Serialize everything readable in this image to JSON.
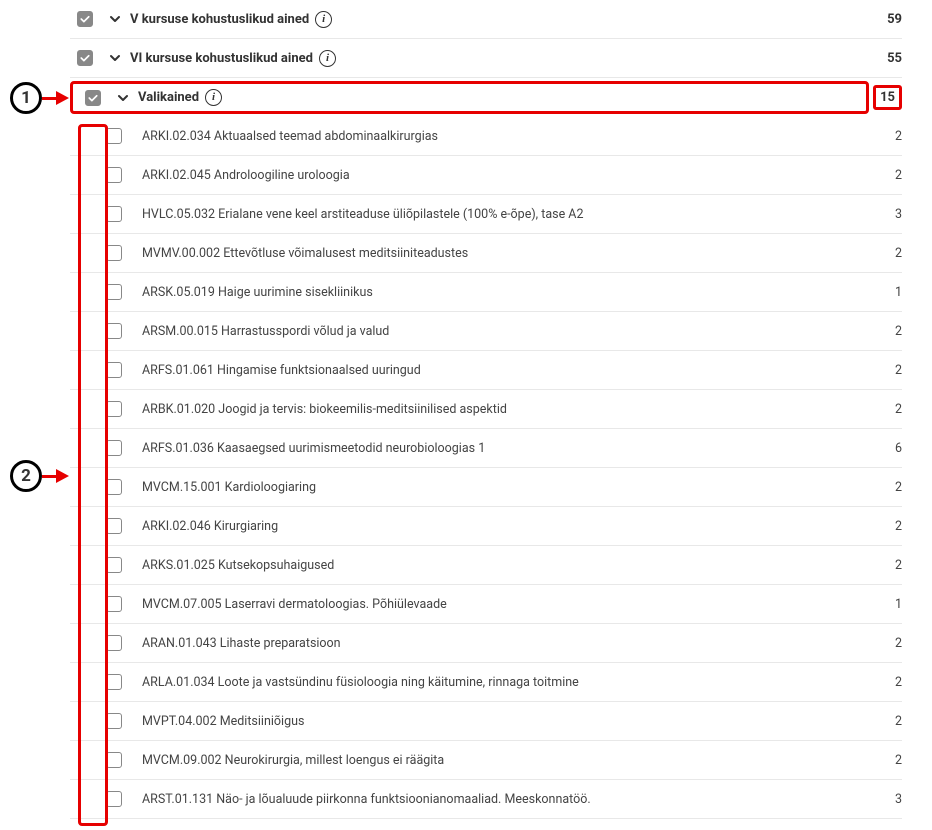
{
  "sections": [
    {
      "label": "V kursuse kohustuslikud ained",
      "credits": "59",
      "checked": true,
      "highlighted": false
    },
    {
      "label": "VI kursuse kohustuslikud ained",
      "credits": "55",
      "checked": true,
      "highlighted": false
    },
    {
      "label": "Valikained",
      "credits": "15",
      "checked": true,
      "highlighted": true
    }
  ],
  "courses": [
    {
      "name": "ARKI.02.034 Aktuaalsed teemad abdominaalkirurgias",
      "credits": "2"
    },
    {
      "name": "ARKI.02.045 Androloogiline uroloogia",
      "credits": "2"
    },
    {
      "name": "HVLC.05.032 Erialane vene keel arstiteaduse üliõpilastele (100% e-õpe), tase A2",
      "credits": "3"
    },
    {
      "name": "MVMV.00.002 Ettevõtluse võimalusest meditsiiniteadustes",
      "credits": "2"
    },
    {
      "name": "ARSK.05.019 Haige uurimine sisekliinikus",
      "credits": "1"
    },
    {
      "name": "ARSM.00.015 Harrastusspordi võlud ja valud",
      "credits": "2"
    },
    {
      "name": "ARFS.01.061 Hingamise funktsionaalsed uuringud",
      "credits": "2"
    },
    {
      "name": "ARBK.01.020 Joogid ja tervis: biokeemilis-meditsiinilised aspektid",
      "credits": "2"
    },
    {
      "name": "ARFS.01.036 Kaasaegsed uurimismeetodid neurobioloogias 1",
      "credits": "6"
    },
    {
      "name": "MVCM.15.001 Kardioloogiaring",
      "credits": "2"
    },
    {
      "name": "ARKI.02.046 Kirurgiaring",
      "credits": "2"
    },
    {
      "name": "ARKS.01.025 Kutsekopsuhaigused",
      "credits": "2"
    },
    {
      "name": "MVCM.07.005 Laserravi dermatoloogias. Põhiülevaade",
      "credits": "1"
    },
    {
      "name": "ARAN.01.043 Lihaste preparatsioon",
      "credits": "2"
    },
    {
      "name": "ARLA.01.034 Loote ja vastsündinu füsioloogia ning käitumine, rinnaga toitmine",
      "credits": "2"
    },
    {
      "name": "MVPT.04.002 Meditsiiniõigus",
      "credits": "2"
    },
    {
      "name": "MVCM.09.002 Neurokirurgia, millest loengus ei räägita",
      "credits": "2"
    },
    {
      "name": "ARST.01.131 Näo- ja lõualuude piirkonna funktsioonianomaaliad. Meeskonnatöö.",
      "credits": "3"
    }
  ],
  "callouts": {
    "c1": "1",
    "c2": "2"
  }
}
